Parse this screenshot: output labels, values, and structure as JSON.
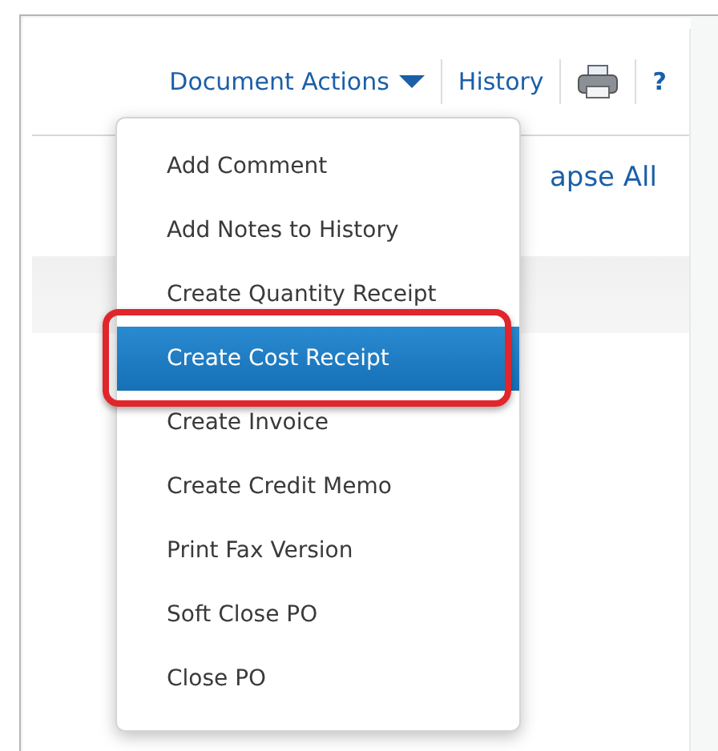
{
  "toolbar": {
    "document_actions": {
      "label": "Document Actions",
      "expanded": true
    },
    "history": "History",
    "help": "?"
  },
  "collapse_all": "apse All",
  "menu": {
    "items": [
      {
        "label": "Add Comment",
        "selected": false,
        "outlined": false
      },
      {
        "label": "Add Notes to History",
        "selected": false,
        "outlined": false
      },
      {
        "label": "Create Quantity Receipt",
        "selected": false,
        "outlined": false
      },
      {
        "label": "Create Cost Receipt",
        "selected": true,
        "outlined": true
      },
      {
        "label": "Create Invoice",
        "selected": false,
        "outlined": false
      },
      {
        "label": "Create Credit Memo",
        "selected": false,
        "outlined": false
      },
      {
        "label": "Print Fax Version",
        "selected": false,
        "outlined": false
      },
      {
        "label": "Soft Close PO",
        "selected": false,
        "outlined": false
      },
      {
        "label": "Close PO",
        "selected": false,
        "outlined": false
      }
    ]
  }
}
